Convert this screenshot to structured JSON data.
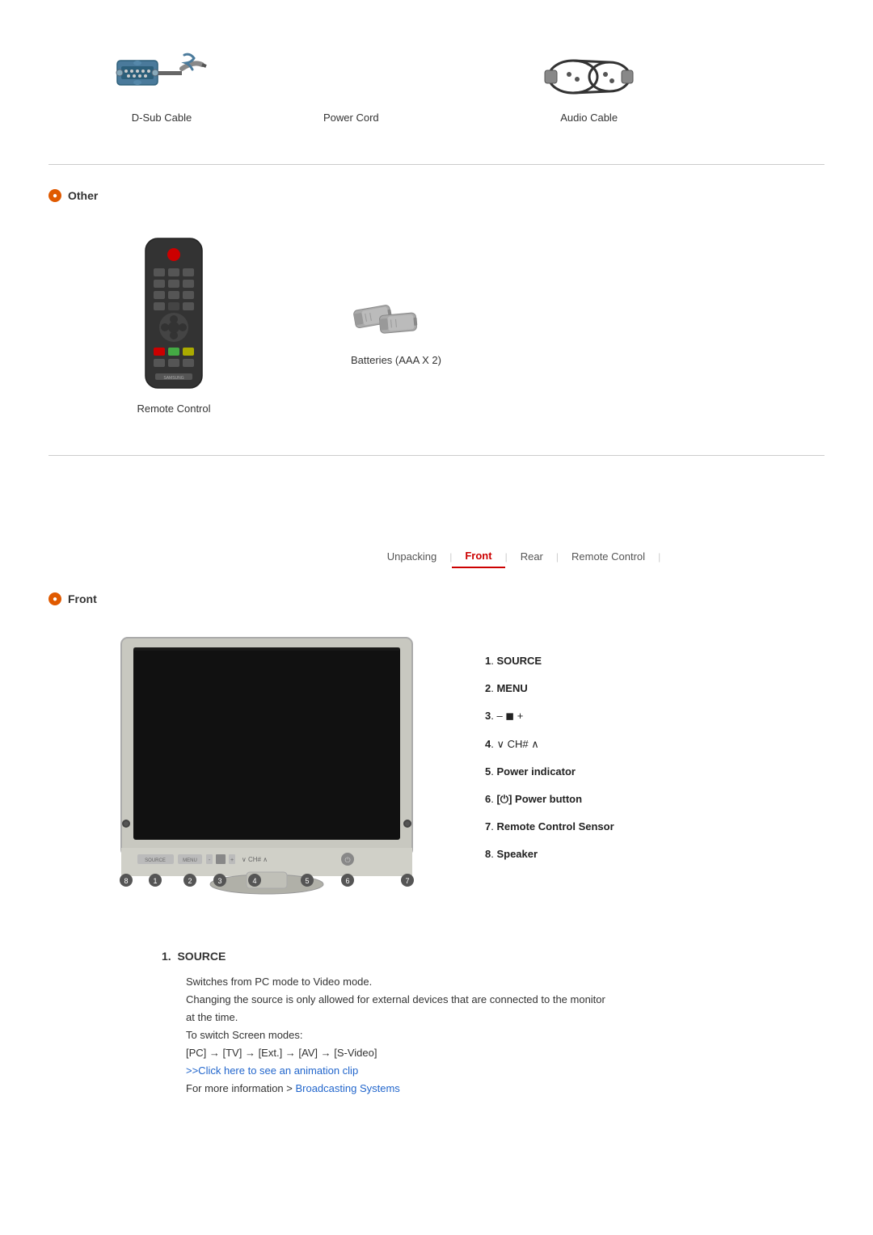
{
  "accessories": {
    "items": [
      {
        "id": "dsub",
        "label": "D-Sub Cable"
      },
      {
        "id": "powercord",
        "label": "Power Cord"
      },
      {
        "id": "audiocable",
        "label": "Audio Cable"
      }
    ]
  },
  "other_section": {
    "title": "Other",
    "items": [
      {
        "id": "remote",
        "label": "Remote Control"
      },
      {
        "id": "batteries",
        "label": "Batteries (AAA X 2)"
      }
    ]
  },
  "navigation": {
    "tabs": [
      {
        "id": "unpacking",
        "label": "Unpacking",
        "active": false
      },
      {
        "id": "front",
        "label": "Front",
        "active": true
      },
      {
        "id": "rear",
        "label": "Rear",
        "active": false
      },
      {
        "id": "remote-control",
        "label": "Remote Control",
        "active": false
      }
    ]
  },
  "front_section": {
    "title": "Front",
    "component_labels": [
      {
        "number": "1",
        "label": "SOURCE"
      },
      {
        "number": "2",
        "label": "MENU"
      },
      {
        "number": "3",
        "label": "– ◼ +"
      },
      {
        "number": "4",
        "label": "∨ CH# ∧"
      },
      {
        "number": "5",
        "label": "Power indicator"
      },
      {
        "number": "6",
        "label": "[⏻] Power button"
      },
      {
        "number": "7",
        "label": "Remote Control Sensor"
      },
      {
        "number": "8",
        "label": "Speaker"
      }
    ]
  },
  "source_description": {
    "number": "1",
    "title": "SOURCE",
    "lines": [
      "Switches from PC mode to Video mode.",
      "Changing the source is only allowed for external devices that are connected to the monitor",
      "at the time.",
      "To switch Screen modes:",
      "[PC]  →  [TV]  →  [Ext.]  →  [AV]  →  [S-Video]"
    ],
    "animation_link_text": ">>Click here to see an animation clip",
    "more_info_text": "For more information > ",
    "broadcasting_text": "Broadcasting Systems"
  },
  "colors": {
    "accent_red": "#cc0000",
    "accent_orange": "#e05a00",
    "link_blue": "#2266cc"
  }
}
